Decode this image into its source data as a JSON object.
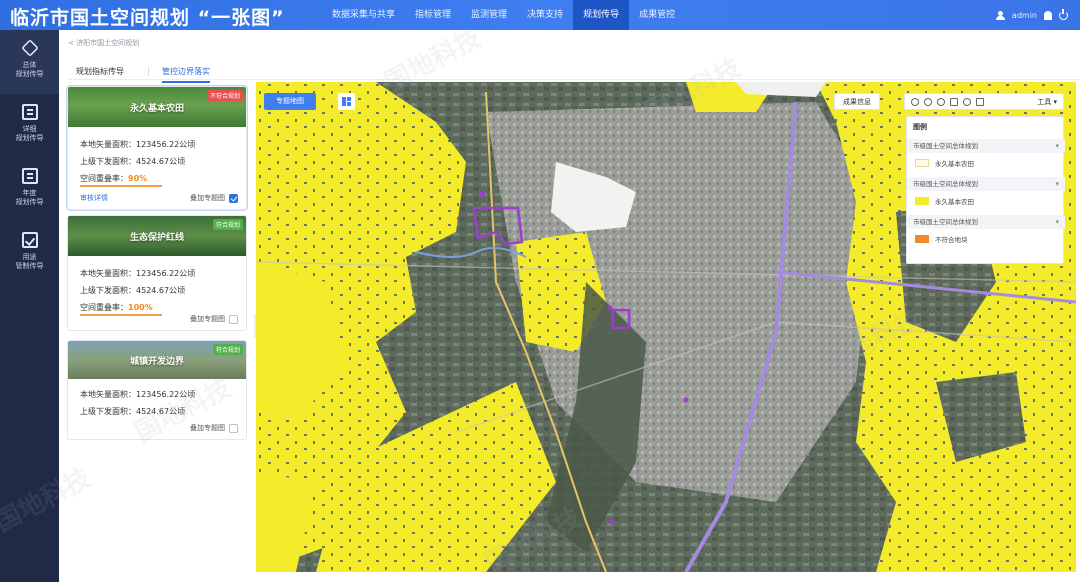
{
  "header": {
    "app_title": "临沂市国土空间规划 “一张图”",
    "nav_items": [
      "数据采集与共享",
      "指标管理",
      "监测管理",
      "决策支持",
      "规划传导",
      "成果管控"
    ],
    "active_nav_index": 4,
    "user_name": "admin"
  },
  "sidebar": {
    "items": [
      {
        "label_line1": "总体",
        "label_line2": "规划传导",
        "icon": "layers-icon"
      },
      {
        "label_line1": "详细",
        "label_line2": "规划传导",
        "icon": "document-icon"
      },
      {
        "label_line1": "年度",
        "label_line2": "规划传导",
        "icon": "list-icon"
      },
      {
        "label_line1": "用途",
        "label_line2": "管制传导",
        "icon": "checklist-icon"
      }
    ]
  },
  "breadcrumb": "< 济阳市国土空间规划",
  "tabs": {
    "tab1": "规划指标传导",
    "tab2": "管控边界落实"
  },
  "cards": [
    {
      "title": "永久基本农田",
      "tag": "不符合规划",
      "tag_color": "#e8504f",
      "area_label": "本地矢量面积：",
      "area_value": "123456.22公顷",
      "issued_label": "上级下发面积：",
      "issued_value": "4524.67公顷",
      "rate_label": "空间重叠率：",
      "rate_value": "90%",
      "link": "审核详情",
      "overlay_label": "叠加专题图",
      "overlay_checked": true
    },
    {
      "title": "生态保护红线",
      "tag": "符合规划",
      "tag_color": "#52b04a",
      "area_label": "本地矢量面积：",
      "area_value": "123456.22公顷",
      "issued_label": "上级下发面积：",
      "issued_value": "4524.67公顷",
      "rate_label": "空间重叠率：",
      "rate_value": "100%",
      "overlay_label": "叠加专题图",
      "overlay_checked": false
    },
    {
      "title": "城镇开发边界",
      "tag": "符合规划",
      "tag_color": "#52b04a",
      "area_label": "本地矢量面积：",
      "area_value": "123456.22公顷",
      "issued_label": "上级下发面积：",
      "issued_value": "4524.67公顷",
      "overlay_label": "叠加专题图",
      "overlay_checked": false
    }
  ],
  "map": {
    "topic_button": "专题地图",
    "info_button": "成果信息",
    "tools_label": "工具 ▾",
    "legend": {
      "title": "图例",
      "sections": [
        {
          "name": "市级国土空间总体规划",
          "item": "永久基本农田",
          "swatch": "#fffbe6"
        },
        {
          "name": "市级国土空间总体规划",
          "item": "永久基本农田",
          "swatch": "#f4ec2a"
        },
        {
          "name": "市级国土空间总体规划",
          "item": "不符合地块",
          "swatch": "#f08a2a"
        }
      ]
    }
  },
  "watermark": "国地科技",
  "colors": {
    "header_blue": "#3f7ef0",
    "sidebar_bg": "#1f2a44",
    "farmland_yellow": "#f4ec2a",
    "conflict_purple": "#9a3fd0"
  }
}
